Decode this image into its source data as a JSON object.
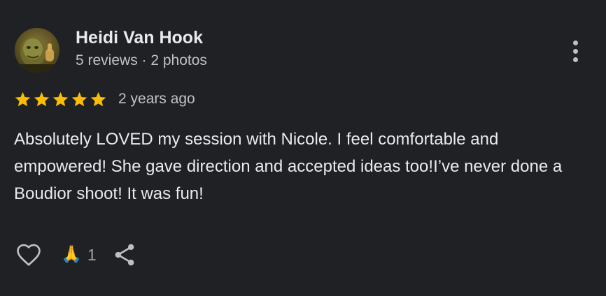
{
  "review": {
    "reviewer": {
      "name": "Heidi Van Hook",
      "meta": "5 reviews · 2 photos",
      "avatar_icon": "reviewer-avatar"
    },
    "rating": {
      "stars": 5,
      "max_stars": 5,
      "star_color": "#fbbc04"
    },
    "time": "2 years ago",
    "text": "Absolutely LOVED my session with Nicole. I feel comfortable and empowered! She gave direction and accepted ideas too!I’ve never done a Boudior shoot! It was fun!",
    "actions": {
      "like_icon": "heart-outline-icon",
      "reaction_emoji": "🙏",
      "reaction_count": "1",
      "share_icon": "share-icon",
      "more_icon": "more-vertical-icon"
    }
  },
  "colors": {
    "background": "#202124",
    "text_primary": "#e8eaed",
    "text_secondary": "#bdc1c6",
    "icon": "#bdc1c6"
  }
}
